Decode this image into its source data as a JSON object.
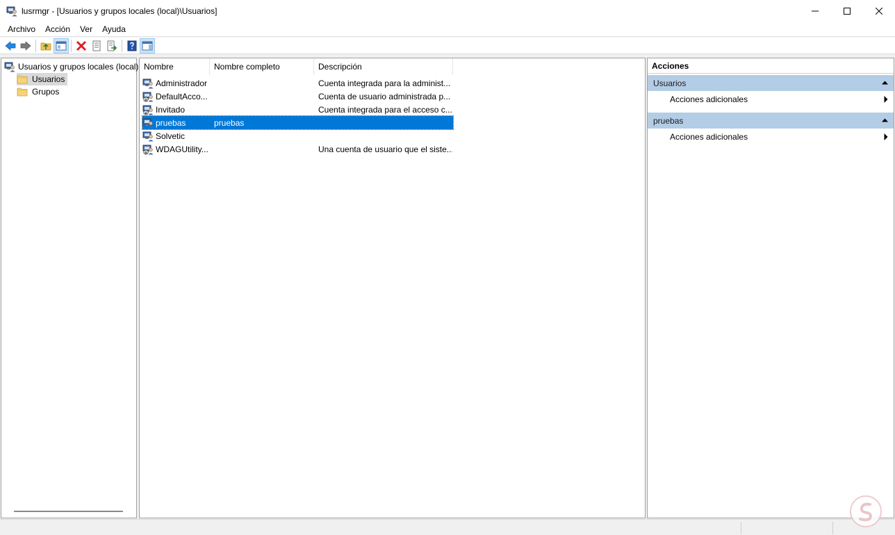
{
  "window": {
    "title": "lusrmgr - [Usuarios y grupos locales (local)\\Usuarios]"
  },
  "menu": [
    "Archivo",
    "Acción",
    "Ver",
    "Ayuda"
  ],
  "tree": {
    "root": "Usuarios y grupos locales (local)",
    "items": [
      {
        "label": "Usuarios",
        "selected": true
      },
      {
        "label": "Grupos",
        "selected": false
      }
    ]
  },
  "list": {
    "columns": [
      "Nombre",
      "Nombre completo",
      "Descripción"
    ],
    "rows": [
      {
        "name": "Administrador",
        "full_name": "",
        "description": "Cuenta integrada para la administ...",
        "disabled": false
      },
      {
        "name": "DefaultAcco...",
        "full_name": "",
        "description": "Cuenta de usuario administrada p...",
        "disabled": true
      },
      {
        "name": "Invitado",
        "full_name": "",
        "description": "Cuenta integrada para el acceso c...",
        "disabled": true
      },
      {
        "name": "pruebas",
        "full_name": "pruebas",
        "description": "",
        "disabled": false,
        "selected": true
      },
      {
        "name": "Solvetic",
        "full_name": "",
        "description": "",
        "disabled": false
      },
      {
        "name": "WDAGUtility...",
        "full_name": "",
        "description": "Una cuenta de usuario que el siste...",
        "disabled": true
      }
    ]
  },
  "actions": {
    "title": "Acciones",
    "sections": [
      {
        "header": "Usuarios",
        "item": "Acciones adicionales"
      },
      {
        "header": "pruebas",
        "item": "Acciones adicionales"
      }
    ]
  },
  "colors": {
    "selection": "#0078d7",
    "action_header": "#b4cde6",
    "tree_selection": "#d9d9d9"
  }
}
